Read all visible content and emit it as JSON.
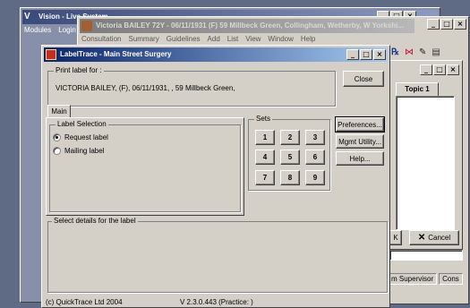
{
  "main_app": {
    "title": "Vision - Live System",
    "menu": [
      "Modules",
      "Login"
    ]
  },
  "patient_window": {
    "title": "Victoria BAILEY 72Y - 06/11/1931 (F)  59 Millbeck Green, Collingham, Wetherby, W Yorkshi...",
    "menu": [
      "Consultation",
      "Summary",
      "Guidelines",
      "Add",
      "List",
      "View",
      "Window",
      "Help"
    ],
    "toolbar_icons": [
      "script-icon",
      "bow-icon",
      "pen-icon",
      "notes-icon"
    ],
    "side_panel_tab": "Topic 1",
    "ok_suffix": "K",
    "cancel_label": "Cancel",
    "status_items": [
      "m Supervisor",
      "Cons"
    ]
  },
  "labeltrace": {
    "title": "LabelTrace - Main Street Surgery",
    "print_label_group": "Print label for :",
    "print_label_value": "VICTORIA BAILEY, (F), 06/11/1931, , 59 Millbeck Green,",
    "close_label": "Close",
    "tab_main": "Main",
    "label_selection_group": "Label Selection",
    "radios": [
      {
        "label": "Request label",
        "checked": true
      },
      {
        "label": "Mailing label",
        "checked": false
      }
    ],
    "sets_group": "Sets",
    "sets": [
      "1",
      "2",
      "3",
      "4",
      "5",
      "6",
      "7",
      "8",
      "9"
    ],
    "preferences_label": "Preferences...",
    "mgmt_label": "Mgmt Utility...",
    "help_label": "Help...",
    "details_group": "Select details for the label",
    "status_left": "(c) QuickTrace Ltd 2004",
    "status_right": "V 2.3.0.443  (Practice: )"
  }
}
